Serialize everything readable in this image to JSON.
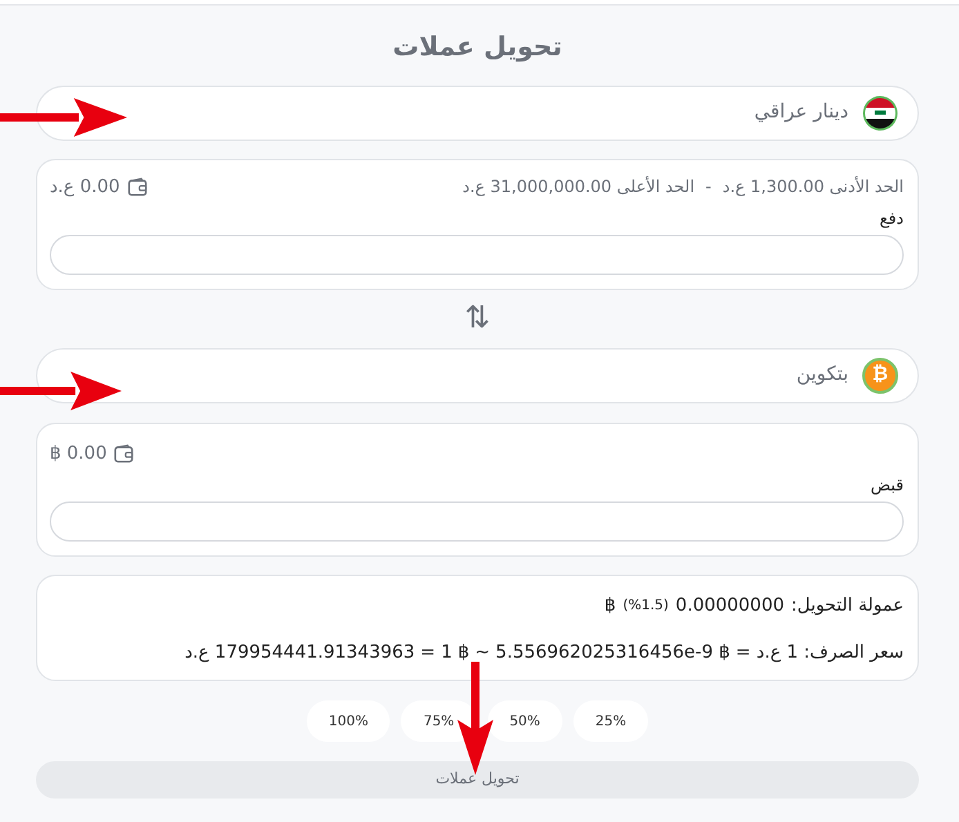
{
  "title": "تحويل عملات",
  "pay": {
    "currency": {
      "kind": "iraq",
      "name": "دينار عراقي"
    },
    "limits": [
      "الحد الأدنى 1,300.00 ع.د",
      "-",
      "الحد الأعلى 31,000,000.00 ع.د"
    ],
    "balance": "0.00 ع.د",
    "label": "دفع"
  },
  "swap_glyph": "⇅",
  "receive": {
    "currency": {
      "kind": "bitcoin",
      "glyph": "₿",
      "name": "بتكوين"
    },
    "balance": "0.00 ฿",
    "label": "قبض"
  },
  "fee": {
    "label": "عمولة التحويل:",
    "amount": "0.00000000",
    "percent": "(%1.5)",
    "symbol": "฿"
  },
  "rate": [
    "سعر الصرف: 1 ع.د =",
    "฿ 5.556962025316456e-9",
    "~",
    "฿",
    "1",
    "=",
    "179954441.91343963 ع.د"
  ],
  "percent_buttons": [
    "25%",
    "50%",
    "75%",
    "100%"
  ],
  "submit": {
    "label": "تحويل عملات",
    "disabled": true
  }
}
